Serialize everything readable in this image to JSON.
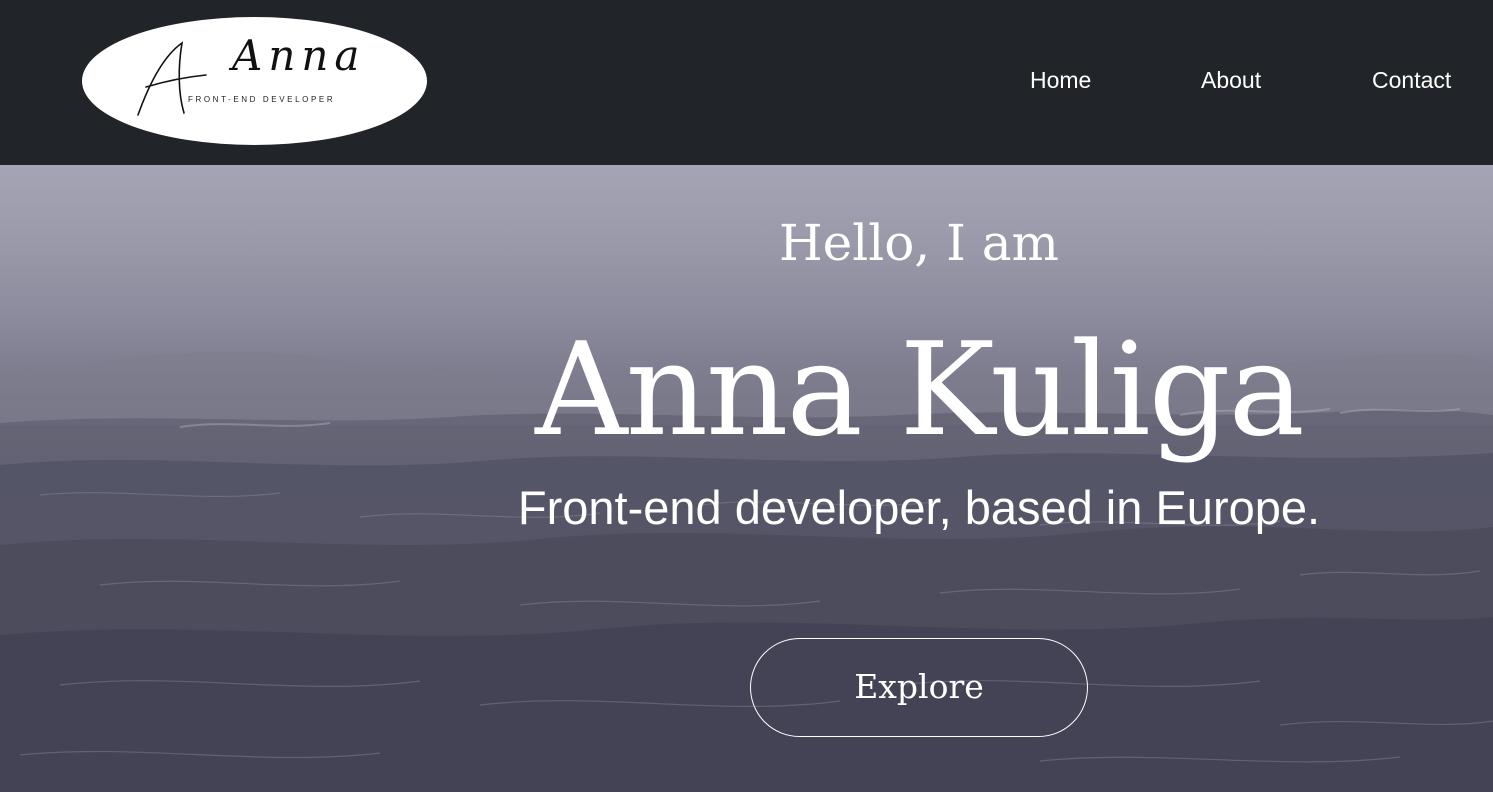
{
  "navbar": {
    "logo": {
      "script_text": "Anna",
      "subtitle": "FRONT-END DEVELOPER"
    },
    "links": [
      {
        "label": "Home"
      },
      {
        "label": "About"
      },
      {
        "label": "Contact"
      }
    ]
  },
  "hero": {
    "greeting": "Hello, I am",
    "name": "Anna Kuliga",
    "tagline": "Front-end developer, based in Europe.",
    "cta_label": "Explore",
    "background": "ocean-waves-image"
  },
  "colors": {
    "navbar_bg": "#212529",
    "text": "#ffffff",
    "logo_bg": "#ffffff"
  }
}
